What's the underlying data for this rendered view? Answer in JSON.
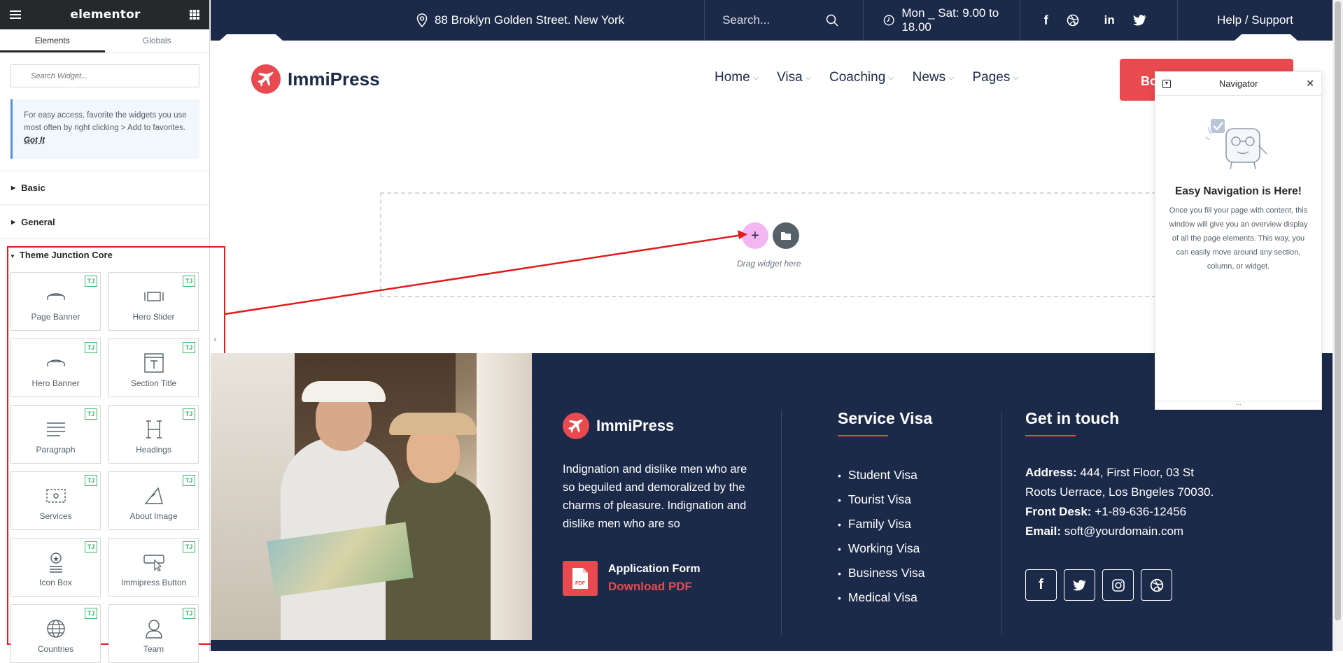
{
  "panel": {
    "logo": "elementor",
    "tabs": [
      "Elements",
      "Globals"
    ],
    "search_placeholder": "Search Widget...",
    "tip_text": "For easy access, favorite the widgets you use most often by right clicking > Add to favorites.",
    "tip_link": "Got It",
    "categories": [
      "Basic",
      "General",
      "Theme Junction Core"
    ],
    "widget_badge": "TJ",
    "widgets": [
      "Page Banner",
      "Hero Slider",
      "Hero Banner",
      "Section Title",
      "Paragraph",
      "Headings",
      "Services",
      "About Image",
      "Icon Box",
      "Immipress Button",
      "Countries",
      "Team"
    ]
  },
  "topbar": {
    "address": "88 Broklyn Golden Street. New York",
    "search_placeholder": "Search...",
    "hours": "Mon _ Sat: 9.00 to 18.00",
    "support": "Help / Support"
  },
  "header": {
    "logo": "ImmiPress",
    "nav": [
      "Home",
      "Visa",
      "Coaching",
      "News",
      "Pages"
    ],
    "book_button": "Bo"
  },
  "canvas": {
    "drag_text": "Drag widget here",
    "add_icon": "+"
  },
  "footer": {
    "logo": "ImmiPress",
    "description": "Indignation and dislike men who are so beguiled and demoralized by the charms of pleasure. Indignation and dislike men who are so",
    "pdf_title": "Application Form",
    "pdf_link": "Download PDF",
    "services_heading": "Service Visa",
    "visa_list": [
      "Student Visa",
      "Tourist Visa",
      "Family Visa",
      "Working Visa",
      "Business Visa",
      "Medical Visa"
    ],
    "contact_heading": "Get in touch",
    "contact": {
      "address_label": "Address:",
      "address_value": " 444, First Floor, 03 St",
      "address_line2": "Roots Uerrace, Los Bngeles 70030.",
      "desk_label": "Front Desk:",
      "desk_value": " +1-89-636-12456",
      "email_label": "Email:",
      "email_value": " soft@yourdomain.com"
    }
  },
  "navigator": {
    "title": "Navigator",
    "empty_title": "Easy Navigation is Here!",
    "empty_desc": "Once you fill your page with content, this window will give you an overview display of all the page elements. This way, you can easily move around any section, column, or widget.",
    "resize_handle": "..."
  },
  "colors": {
    "brand_red": "#e84a4f",
    "navy": "#1c2a4a",
    "highlight_red": "#e11b1b",
    "badge_green": "#3db26a"
  }
}
